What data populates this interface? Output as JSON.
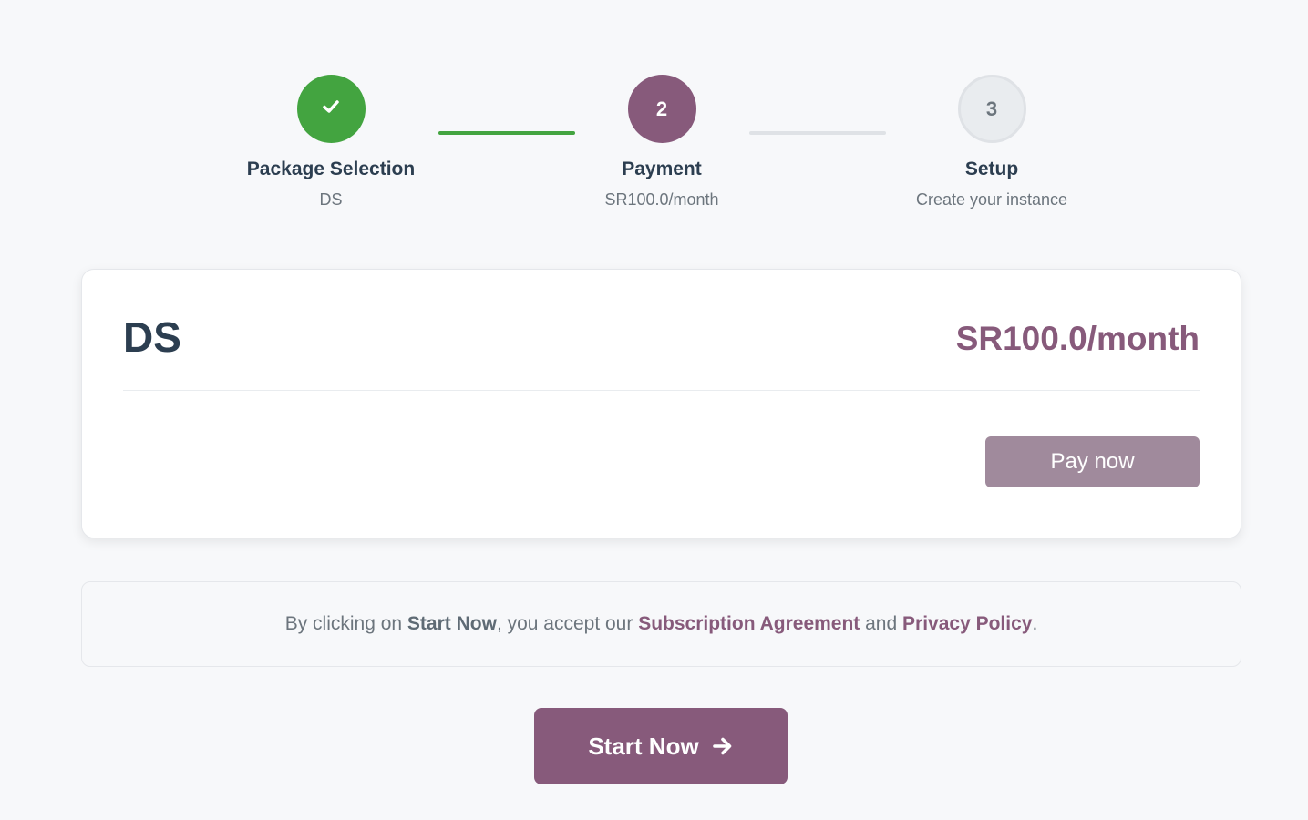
{
  "stepper": {
    "steps": [
      {
        "status": "done",
        "icon": "check-icon",
        "number": "",
        "title": "Package Selection",
        "subtitle": "DS"
      },
      {
        "status": "active",
        "number": "2",
        "title": "Payment",
        "subtitle": "SR100.0/month"
      },
      {
        "status": "pending",
        "number": "3",
        "title": "Setup",
        "subtitle": "Create your instance"
      }
    ]
  },
  "package": {
    "name": "DS",
    "price": "SR100.0/month",
    "pay_label": "Pay now"
  },
  "agreement": {
    "prefix": "By clicking on ",
    "action": "Start Now",
    "middle": ", you accept our ",
    "subscription_link": "Subscription Agreement",
    "conjunction": " and ",
    "privacy_link": "Privacy Policy",
    "suffix": "."
  },
  "start_button": {
    "label": "Start Now",
    "icon": "arrow-right-icon"
  },
  "colors": {
    "background": "#f7f8fa",
    "done": "#43a440",
    "brand": "#875a7b",
    "pay_button": "#a08a9c",
    "pending": "#e9ecef",
    "text": "#2c3e50",
    "muted": "#6c757d"
  }
}
